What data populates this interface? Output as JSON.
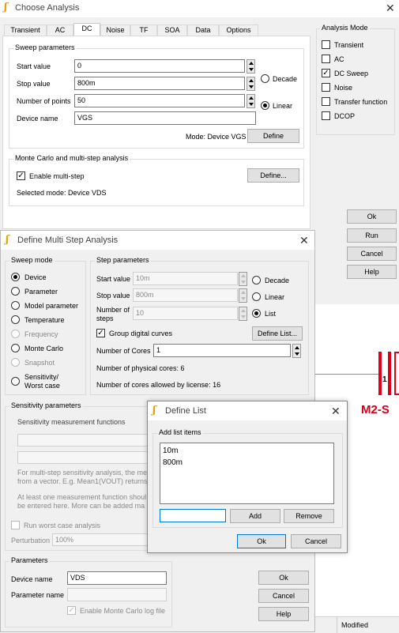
{
  "choose": {
    "title": "Choose Analysis",
    "tabs": [
      "Transient",
      "AC",
      "DC",
      "Noise",
      "TF",
      "SOA",
      "Data",
      "Options"
    ],
    "sweep_title": "Sweep parameters",
    "start_label": "Start value",
    "start_value": "0",
    "stop_label": "Stop value",
    "stop_value": "800m",
    "points_label": "Number of points",
    "points_value": "50",
    "device_label": "Device name",
    "device_value": "VGS",
    "decade": "Decade",
    "linear": "Linear",
    "mode_text": "Mode: Device VGS",
    "define_btn": "Define",
    "mc_title": "Monte Carlo and multi-step analysis",
    "enable_multistep": "Enable multi-step",
    "define_dots_btn": "Define...",
    "selected_mode": "Selected mode: Device VDS",
    "analysis_mode_title": "Analysis Mode",
    "modes": [
      "Transient",
      "AC",
      "DC Sweep",
      "Noise",
      "Transfer function",
      "DCOP"
    ],
    "ok": "Ok",
    "run": "Run",
    "cancel": "Cancel",
    "help": "Help"
  },
  "multistep": {
    "title": "Define Multi Step Analysis",
    "sweep_mode_title": "Sweep mode",
    "sweep_modes": [
      "Device",
      "Parameter",
      "Model parameter",
      "Temperature",
      "Frequency",
      "Monte Carlo",
      "Snapshot",
      "Sensitivity/",
      "Worst case"
    ],
    "step_title": "Step parameters",
    "start_label": "Start value",
    "start_value": "10m",
    "stop_label": "Stop value",
    "stop_value": "800m",
    "steps_label_1": "Number of",
    "steps_label_2": "steps",
    "steps_value": "10",
    "decade": "Decade",
    "linear": "Linear",
    "list": "List",
    "group_digital": "Group digital curves",
    "define_list_btn": "Define List...",
    "cores_label": "Number of Cores",
    "cores_value": "1",
    "physical_cores": "Number of physical cores: 6",
    "license_cores": "Number of cores allowed by license: 16",
    "sens_title": "Sensitivity parameters",
    "sens_funcs": "Sensitivity measurement functions",
    "sens_text_1": "For multi-step sensitivity analysis, the me",
    "sens_text_2": "from a vector. E.g. Mean1(VOUT) returns",
    "sens_text_3": "At least one measurement function shoul",
    "sens_text_4": "be entered here. More can be added ma",
    "run_worst": "Run worst case analysis",
    "perturbation_label": "Perturbation",
    "perturbation_value": "100%",
    "params_title": "Parameters",
    "device_label": "Device name",
    "device_value": "VDS",
    "param_label": "Parameter name",
    "param_value": "",
    "enable_mc_log": "Enable Monte Carlo log file",
    "ok": "Ok",
    "cancel": "Cancel",
    "help": "Help"
  },
  "deflist": {
    "title": "Define List",
    "group_title": "Add list items",
    "items": [
      "10m",
      "800m"
    ],
    "input_value": "",
    "add": "Add",
    "remove": "Remove",
    "ok": "Ok",
    "cancel": "Cancel"
  },
  "schematic": {
    "component_label": "M2-S",
    "pin_label": "1",
    "status": "Modified"
  }
}
